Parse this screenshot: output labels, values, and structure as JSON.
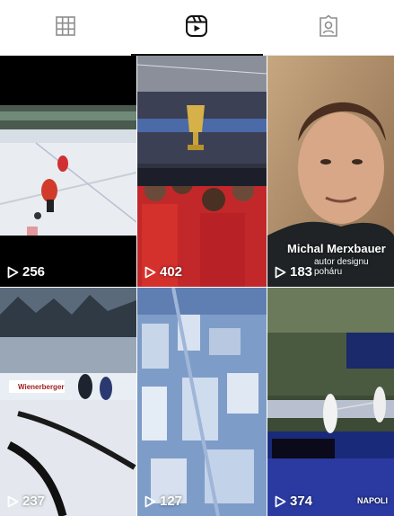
{
  "tabs": [
    {
      "icon": "grid-icon"
    },
    {
      "icon": "reels-icon"
    },
    {
      "icon": "tagged-icon"
    }
  ],
  "active_tab": 1,
  "reels": [
    {
      "views": "256"
    },
    {
      "views": "402"
    },
    {
      "views": "183",
      "caption_name": "Michal Merxbauer",
      "caption_sub": "autor designu poháru"
    },
    {
      "views": "237",
      "banner_text": "Wienerberger"
    },
    {
      "views": "127"
    },
    {
      "views": "374",
      "banner_text": "NAPOLI"
    }
  ]
}
